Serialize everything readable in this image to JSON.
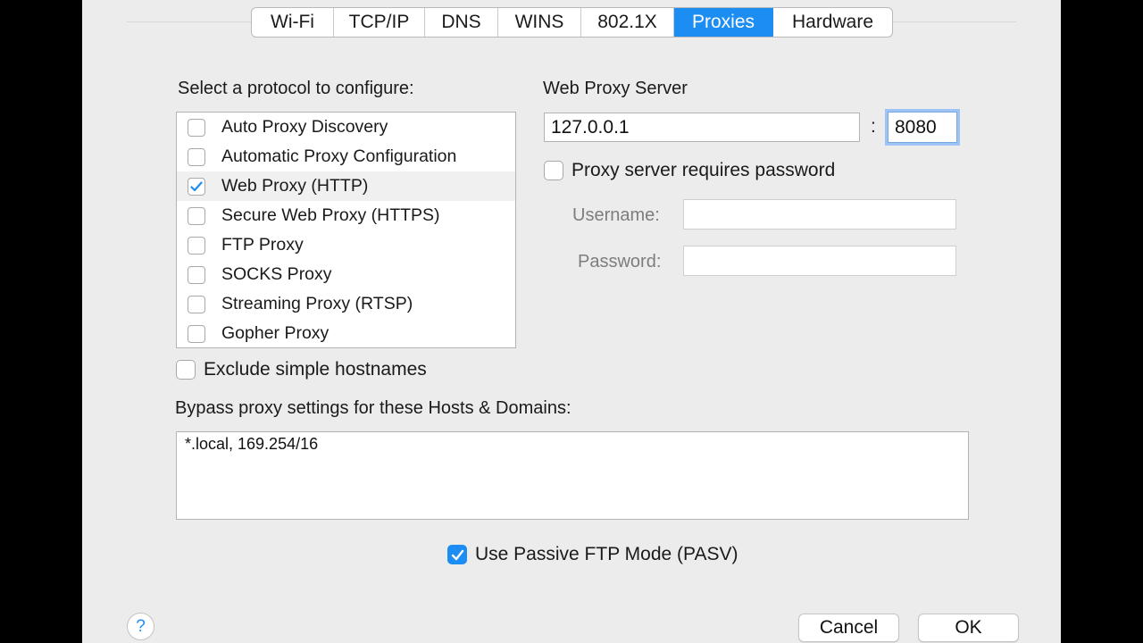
{
  "tabs": [
    {
      "label": "Wi-Fi",
      "active": false
    },
    {
      "label": "TCP/IP",
      "active": false
    },
    {
      "label": "DNS",
      "active": false
    },
    {
      "label": "WINS",
      "active": false
    },
    {
      "label": "802.1X",
      "active": false
    },
    {
      "label": "Proxies",
      "active": true
    },
    {
      "label": "Hardware",
      "active": false
    }
  ],
  "protocols": {
    "heading": "Select a protocol to configure:",
    "items": [
      {
        "label": "Auto Proxy Discovery",
        "checked": false,
        "selected": false
      },
      {
        "label": "Automatic Proxy Configuration",
        "checked": false,
        "selected": false
      },
      {
        "label": "Web Proxy (HTTP)",
        "checked": true,
        "selected": true
      },
      {
        "label": "Secure Web Proxy (HTTPS)",
        "checked": false,
        "selected": false
      },
      {
        "label": "FTP Proxy",
        "checked": false,
        "selected": false
      },
      {
        "label": "SOCKS Proxy",
        "checked": false,
        "selected": false
      },
      {
        "label": "Streaming Proxy (RTSP)",
        "checked": false,
        "selected": false
      },
      {
        "label": "Gopher Proxy",
        "checked": false,
        "selected": false
      }
    ]
  },
  "server": {
    "heading": "Web Proxy Server",
    "host": "127.0.0.1",
    "separator": ":",
    "port": "8080",
    "requires_password_label": "Proxy server requires password",
    "requires_password": false,
    "username_label": "Username:",
    "username": "",
    "password_label": "Password:",
    "password": ""
  },
  "exclude_simple": {
    "label": "Exclude simple hostnames",
    "checked": false
  },
  "bypass": {
    "heading": "Bypass proxy settings for these Hosts & Domains:",
    "value": "*.local, 169.254/16"
  },
  "passive_ftp": {
    "label": "Use Passive FTP Mode (PASV)",
    "checked": true
  },
  "buttons": {
    "help": "?",
    "cancel": "Cancel",
    "ok": "OK"
  },
  "colors": {
    "accent": "#1b8df3",
    "sheet": "#ececec",
    "backdrop": "#000000"
  },
  "icons": {
    "help": "question-mark-icon",
    "check": "checkmark-icon"
  }
}
